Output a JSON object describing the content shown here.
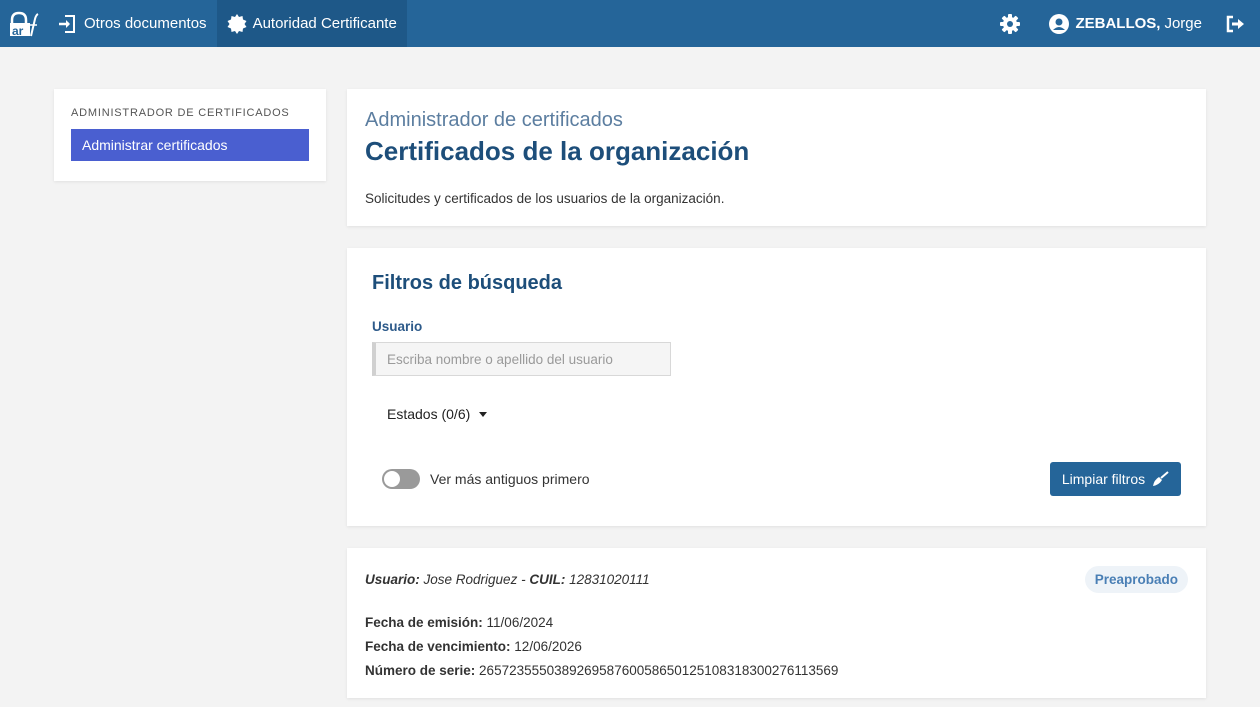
{
  "topbar": {
    "logo_text": "ar",
    "nav": [
      {
        "label": "Otros documentos",
        "icon": "sign-in-icon"
      },
      {
        "label": "Autoridad Certificante",
        "icon": "seal-icon"
      }
    ],
    "user": {
      "last_name": "ZEBALLOS,",
      "first_name": "Jorge"
    }
  },
  "sidebar": {
    "section_title": "ADMINISTRADOR DE CERTIFICADOS",
    "active_item": "Administrar certificados"
  },
  "header": {
    "subtitle": "Administrador de certificados",
    "title": "Certificados de la organización",
    "description": "Solicitudes y certificados de los usuarios de la organización."
  },
  "filters": {
    "title": "Filtros de búsqueda",
    "user_label": "Usuario",
    "user_placeholder": "Escriba nombre o apellido del usuario",
    "user_value": "",
    "estados_label": "Estados (0/6)",
    "toggle_label": "Ver más antiguos primero",
    "toggle_on": false,
    "clear_label": "Limpiar filtros"
  },
  "results": [
    {
      "user_label": "Usuario:",
      "user_name": "Jose Rodriguez",
      "cuil_label": "CUIL:",
      "cuil": "12831020111",
      "status": "Preaprobado",
      "emision_label": "Fecha de emisión:",
      "emision": "11/06/2024",
      "vencimiento_label": "Fecha de vencimiento:",
      "vencimiento": "12/06/2026",
      "serie_label": "Número de serie:",
      "serie": "265723555038926958760058650125108318300276113569"
    }
  ],
  "colors": {
    "topbar": "#256599",
    "active_nav": "#1e5888",
    "sidebar_active": "#4a5fd0",
    "title": "#1d4e7a",
    "badge_text": "#4a7fb5"
  }
}
